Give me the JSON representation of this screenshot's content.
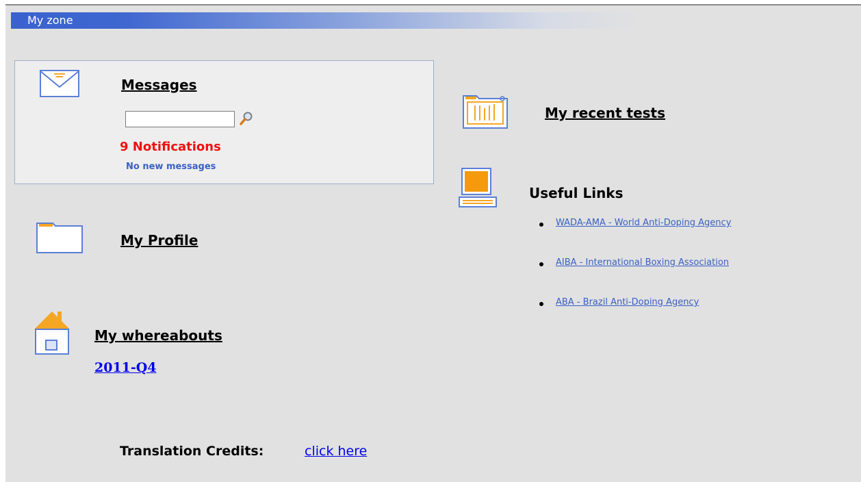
{
  "zone": {
    "title": "My zone"
  },
  "messages": {
    "heading": "Messages",
    "search_value": "",
    "notifications": "9 Notifications",
    "status": "No new messages"
  },
  "profile": {
    "heading": "My Profile"
  },
  "whereabouts": {
    "heading": "My whereabouts",
    "period_link": "2011-Q4"
  },
  "credits": {
    "label": "Translation Credits:",
    "link": "click here"
  },
  "recent_tests": {
    "heading": "My recent tests"
  },
  "useful_links": {
    "heading": "Useful Links",
    "items": [
      {
        "label": "WADA-AMA - World Anti-Doping Agency"
      },
      {
        "label": "AIBA - International Boxing Association"
      },
      {
        "label": "ABA - Brazil Anti-Doping Agency"
      }
    ]
  },
  "icons": {
    "messages": "envelope-icon",
    "search": "magnifier-icon",
    "profile": "folder-icon",
    "whereabouts": "house-icon",
    "recent_tests": "test-folder-icon",
    "useful_links": "computer-icon"
  },
  "colors": {
    "header_blue": "#3a62cf",
    "icon_orange": "#f5a623",
    "notification_red": "#ee1111",
    "link_blue": "#3a5fc4"
  }
}
